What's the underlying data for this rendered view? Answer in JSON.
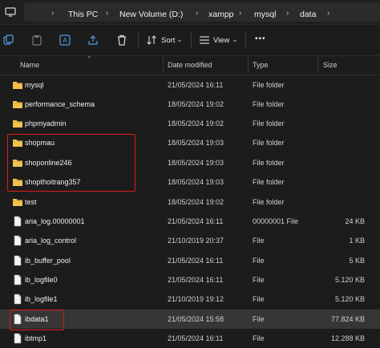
{
  "address": {
    "segments": [
      "This PC",
      "New Volume (D:)",
      "xampp",
      "mysql",
      "data"
    ]
  },
  "toolbar": {
    "sort_label": "Sort",
    "view_label": "View",
    "more_label": "•••"
  },
  "columns": {
    "name": "Name",
    "date": "Date modified",
    "type": "Type",
    "size": "Size"
  },
  "files": [
    {
      "name": "mysql",
      "date": "21/05/2024 16:11",
      "type": "File folder",
      "size": "",
      "icon": "folder-icon"
    },
    {
      "name": "performance_schema",
      "date": "18/05/2024 19:02",
      "type": "File folder",
      "size": "",
      "icon": "folder-icon"
    },
    {
      "name": "phpmyadmin",
      "date": "18/05/2024 19:02",
      "type": "File folder",
      "size": "",
      "icon": "folder-icon"
    },
    {
      "name": "shopmau",
      "date": "18/05/2024 19:03",
      "type": "File folder",
      "size": "",
      "icon": "folder-icon"
    },
    {
      "name": "shoponline246",
      "date": "18/05/2024 19:03",
      "type": "File folder",
      "size": "",
      "icon": "folder-icon"
    },
    {
      "name": "shopthoitrang357",
      "date": "18/05/2024 19:03",
      "type": "File folder",
      "size": "",
      "icon": "folder-icon"
    },
    {
      "name": "test",
      "date": "18/05/2024 19:02",
      "type": "File folder",
      "size": "",
      "icon": "folder-icon"
    },
    {
      "name": "aria_log.00000001",
      "date": "21/05/2024 16:11",
      "type": "00000001 File",
      "size": "24 KB",
      "icon": "file-icon"
    },
    {
      "name": "aria_log_control",
      "date": "21/10/2019 20:37",
      "type": "File",
      "size": "1 KB",
      "icon": "file-icon"
    },
    {
      "name": "ib_buffer_pool",
      "date": "21/05/2024 16:11",
      "type": "File",
      "size": "5 KB",
      "icon": "file-icon"
    },
    {
      "name": "ib_logfile0",
      "date": "21/05/2024 16:11",
      "type": "File",
      "size": "5.120 KB",
      "icon": "file-icon"
    },
    {
      "name": "ib_logfile1",
      "date": "21/10/2019 19:12",
      "type": "File",
      "size": "5.120 KB",
      "icon": "file-icon"
    },
    {
      "name": "ibdata1",
      "date": "21/05/2024 15:58",
      "type": "File",
      "size": "77.824 KB",
      "icon": "file-icon"
    },
    {
      "name": "ibtmp1",
      "date": "21/05/2024 16:11",
      "type": "File",
      "size": "12.288 KB",
      "icon": "file-icon"
    }
  ],
  "colors": {
    "background": "#1c1c1c",
    "folder": "#f2c14e",
    "highlight_box": "#e01a1a",
    "selected_row": "#363636"
  }
}
